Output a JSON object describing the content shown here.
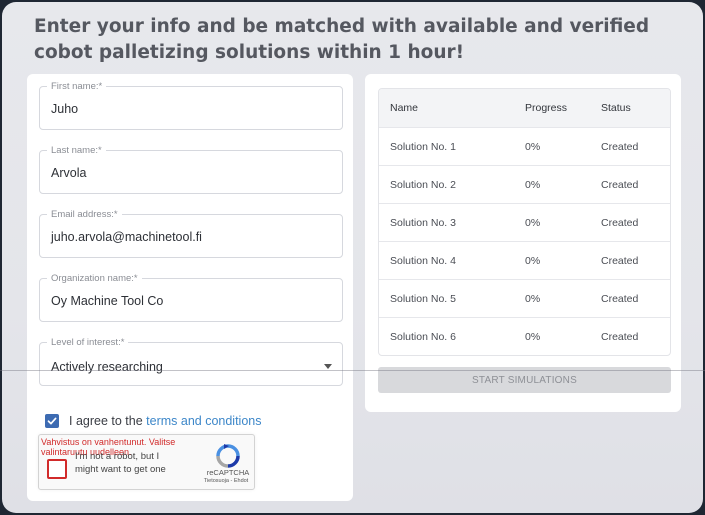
{
  "headline": "Enter your info and be matched with available and verified cobot palletizing solutions within 1 hour!",
  "form": {
    "first_name": {
      "label": "First name:*",
      "value": "Juho"
    },
    "last_name": {
      "label": "Last name:*",
      "value": "Arvola"
    },
    "email": {
      "label": "Email address:*",
      "value": "juho.arvola@machinetool.fi"
    },
    "organization": {
      "label": "Organization name:*",
      "value": "Oy Machine Tool Co"
    },
    "interest": {
      "label": "Level of interest:*",
      "selected": "Actively researching"
    },
    "agree_prefix": "I agree to the ",
    "agree_link": "terms and conditions",
    "agree_checked": true
  },
  "recaptcha": {
    "error": "Vahvistus on vanhentunut. Valitse valintaruutu uudelleen.",
    "label": "I'm not a robot, but I might want to get one",
    "brand": "reCAPTCHA",
    "links": "Tietosuoja - Ehdot"
  },
  "table": {
    "columns": [
      "Name",
      "Progress",
      "Status"
    ],
    "rows": [
      [
        "Solution No. 1",
        "0%",
        "Created"
      ],
      [
        "Solution No. 2",
        "0%",
        "Created"
      ],
      [
        "Solution No. 3",
        "0%",
        "Created"
      ],
      [
        "Solution No. 4",
        "0%",
        "Created"
      ],
      [
        "Solution No. 5",
        "0%",
        "Created"
      ],
      [
        "Solution No. 6",
        "0%",
        "Created"
      ]
    ]
  },
  "start_button": "START SIMULATIONS",
  "colors": {
    "accent": "#3d6bb2",
    "link": "#3d87c9",
    "error": "#d12a2a"
  }
}
